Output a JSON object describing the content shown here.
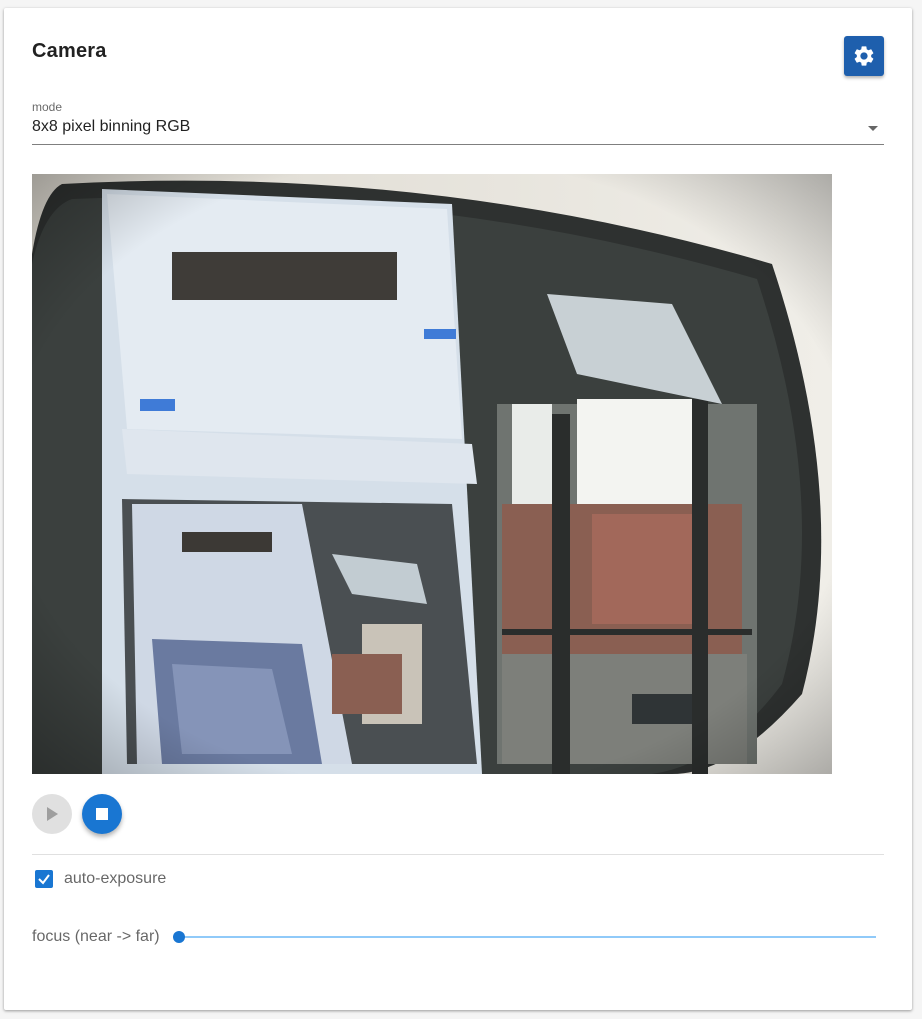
{
  "card": {
    "title": "Camera",
    "settings_icon": "gear-icon"
  },
  "mode": {
    "label": "mode",
    "value": "8x8 pixel binning RGB"
  },
  "camera": {
    "feed": "live-camera-preview"
  },
  "controls": {
    "play_icon": "play-icon",
    "stop_icon": "stop-icon"
  },
  "auto_exposure": {
    "label": "auto-exposure",
    "checked": true
  },
  "focus": {
    "label": "focus (near -> far)",
    "value_fraction": 0.0
  },
  "colors": {
    "accent": "#1976d2",
    "settings_button": "#1e5fad"
  }
}
